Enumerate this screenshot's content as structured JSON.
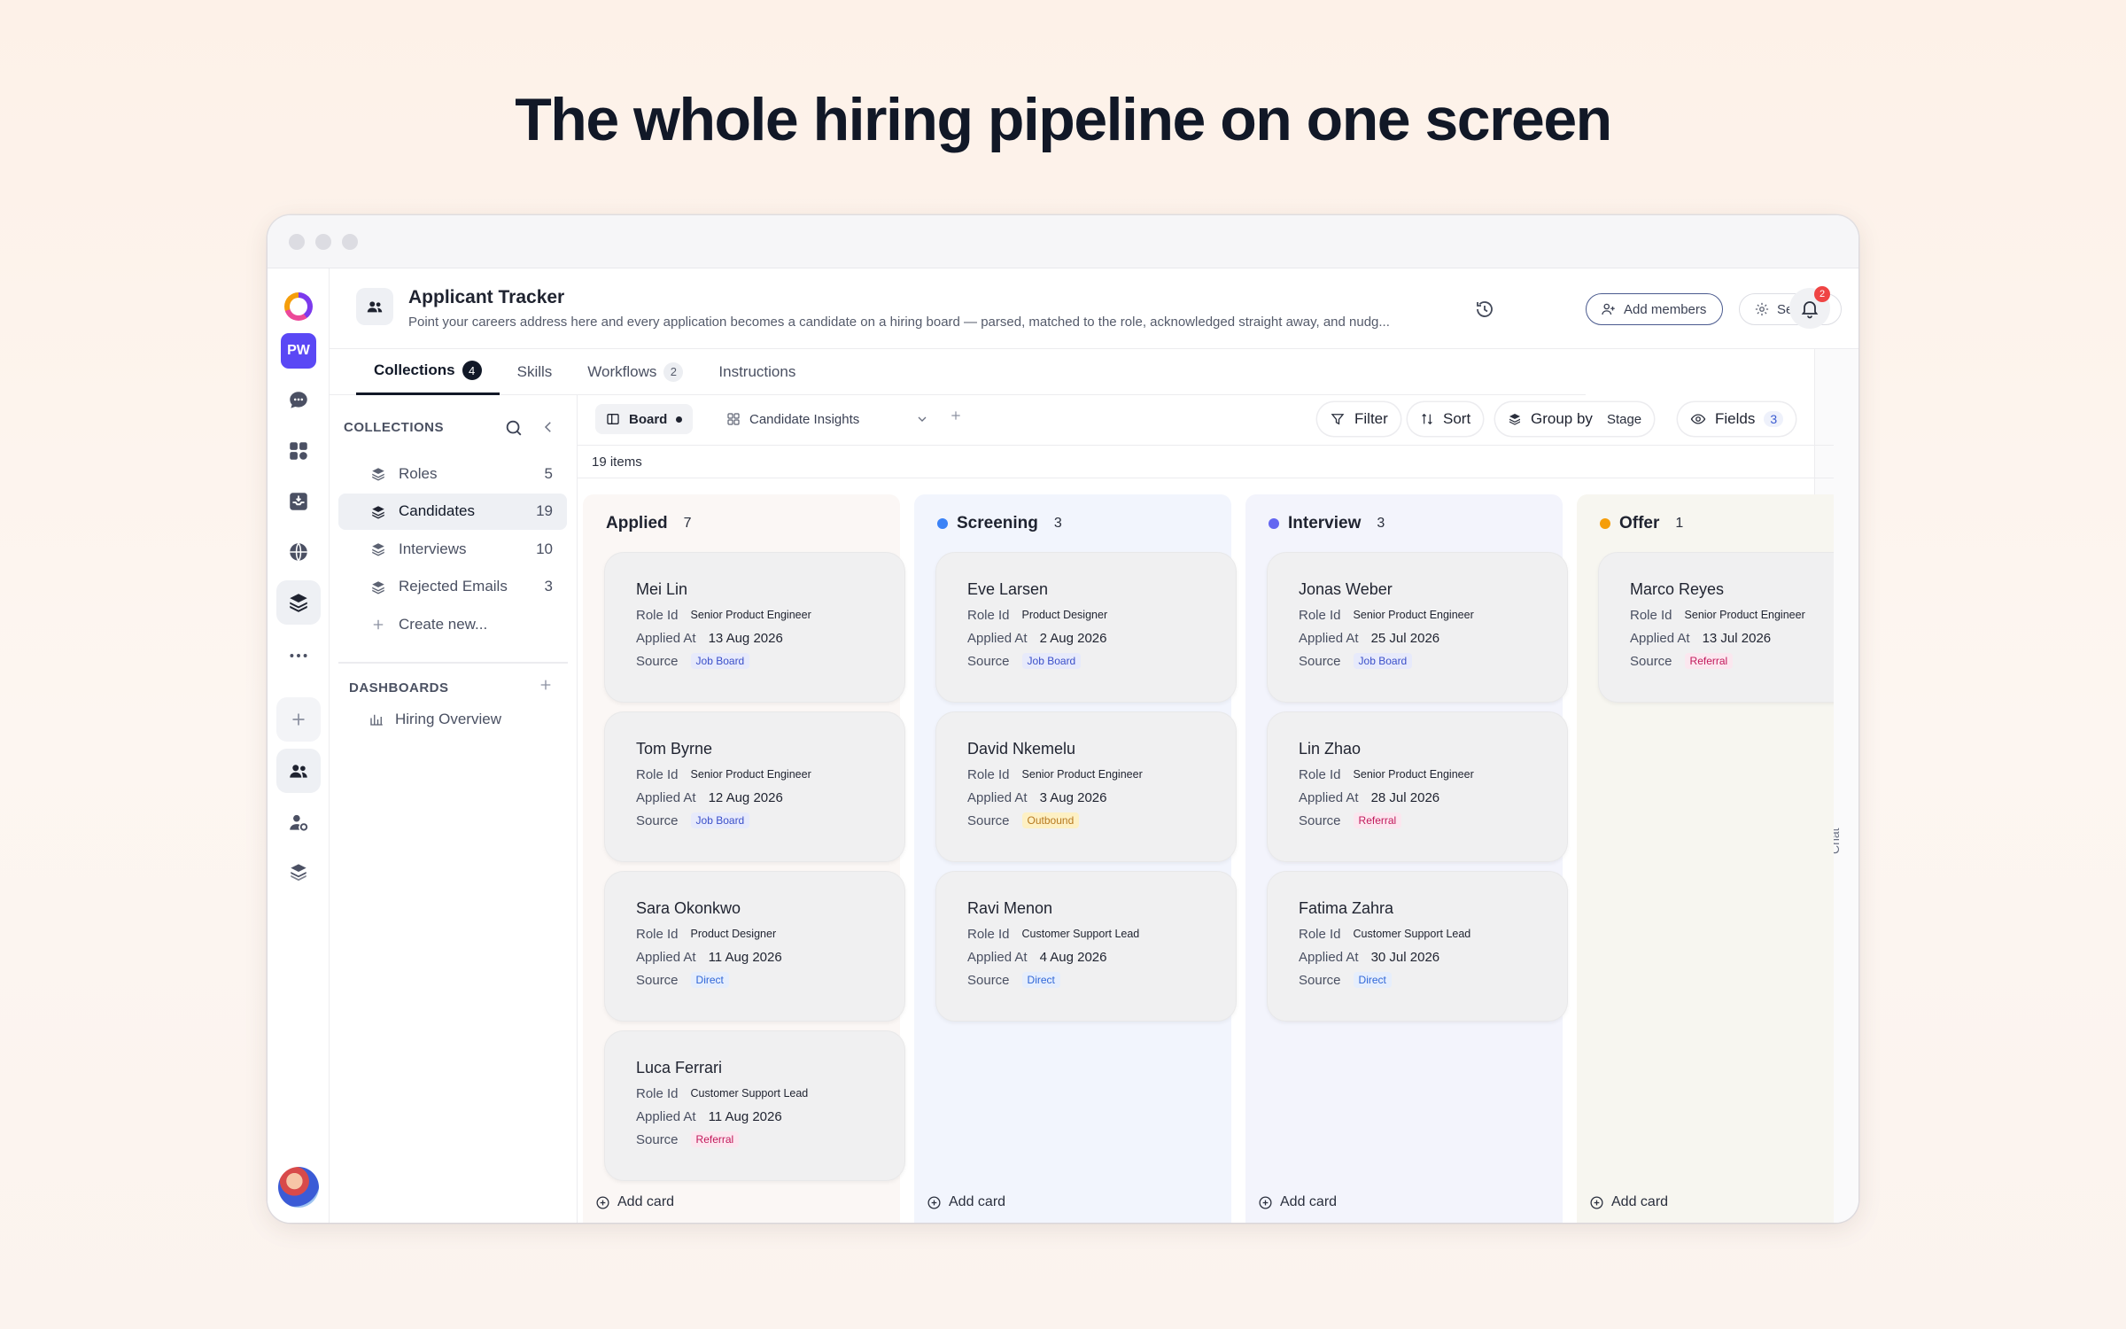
{
  "headline": "The whole hiring pipeline on one screen",
  "rail": {
    "badge": "PW"
  },
  "header": {
    "title": "Applicant Tracker",
    "description": "Point your careers address here and every application becomes a candidate on a hiring board — parsed, matched to the role, acknowledged straight away, and nudg...",
    "add_members": "Add members",
    "settings": "Settings",
    "notifications": "2"
  },
  "tabs": [
    {
      "label": "Collections",
      "count": "4"
    },
    {
      "label": "Skills",
      "count": ""
    },
    {
      "label": "Workflows",
      "count": "2"
    },
    {
      "label": "Instructions",
      "count": ""
    }
  ],
  "chat_label": "Chat",
  "sidebar": {
    "heading": "COLLECTIONS",
    "items": [
      {
        "label": "Roles",
        "count": "5"
      },
      {
        "label": "Candidates",
        "count": "19"
      },
      {
        "label": "Interviews",
        "count": "10"
      },
      {
        "label": "Rejected Emails",
        "count": "3"
      }
    ],
    "create_new": "Create new...",
    "dashboards_heading": "DASHBOARDS",
    "dashboard_item": "Hiring Overview"
  },
  "toolbar": {
    "board": "Board",
    "insights": "Candidate Insights",
    "filter": "Filter",
    "sort": "Sort",
    "group_by": "Group by",
    "group_value": "Stage",
    "fields": "Fields",
    "fields_count": "3"
  },
  "items_count": "19 items",
  "colors": {
    "source_job_board": "#3a4fc9",
    "source_referral": "#c2185b",
    "source_direct": "#2f66d8",
    "source_outbound": "#b7791f"
  },
  "columns": [
    {
      "name": "Applied",
      "count": "7",
      "dot": "",
      "bg": "#fbf7f5",
      "add": "Add card",
      "cards": [
        {
          "name": "Mei Lin",
          "role_label": "Role Id",
          "role": "Senior Product Engineer",
          "applied_label": "Applied At",
          "applied": "13 Aug 2026",
          "source_label": "Source",
          "source": "Job Board",
          "source_type": "job"
        },
        {
          "name": "Tom Byrne",
          "role_label": "Role Id",
          "role": "Senior Product Engineer",
          "applied_label": "Applied At",
          "applied": "12 Aug 2026",
          "source_label": "Source",
          "source": "Job Board",
          "source_type": "job"
        },
        {
          "name": "Sara Okonkwo",
          "role_label": "Role Id",
          "role": "Product Designer",
          "applied_label": "Applied At",
          "applied": "11 Aug 2026",
          "source_label": "Source",
          "source": "Direct",
          "source_type": "direct"
        },
        {
          "name": "Luca Ferrari",
          "role_label": "Role Id",
          "role": "Customer Support Lead",
          "applied_label": "Applied At",
          "applied": "11 Aug 2026",
          "source_label": "Source",
          "source": "Referral",
          "source_type": "referral"
        }
      ]
    },
    {
      "name": "Screening",
      "count": "3",
      "dot": "#3b82f6",
      "bg": "#f2f5fd",
      "add": "Add card",
      "cards": [
        {
          "name": "Eve Larsen",
          "role_label": "Role Id",
          "role": "Product Designer",
          "applied_label": "Applied At",
          "applied": "2 Aug 2026",
          "source_label": "Source",
          "source": "Job Board",
          "source_type": "job"
        },
        {
          "name": "David Nkemelu",
          "role_label": "Role Id",
          "role": "Senior Product Engineer",
          "applied_label": "Applied At",
          "applied": "3 Aug 2026",
          "source_label": "Source",
          "source": "Outbound",
          "source_type": "outbound"
        },
        {
          "name": "Ravi Menon",
          "role_label": "Role Id",
          "role": "Customer Support Lead",
          "applied_label": "Applied At",
          "applied": "4 Aug 2026",
          "source_label": "Source",
          "source": "Direct",
          "source_type": "direct"
        }
      ]
    },
    {
      "name": "Interview",
      "count": "3",
      "dot": "#6366f1",
      "bg": "#f3f4fc",
      "add": "Add card",
      "cards": [
        {
          "name": "Jonas Weber",
          "role_label": "Role Id",
          "role": "Senior Product Engineer",
          "applied_label": "Applied At",
          "applied": "25 Jul 2026",
          "source_label": "Source",
          "source": "Job Board",
          "source_type": "job"
        },
        {
          "name": "Lin Zhao",
          "role_label": "Role Id",
          "role": "Senior Product Engineer",
          "applied_label": "Applied At",
          "applied": "28 Jul 2026",
          "source_label": "Source",
          "source": "Referral",
          "source_type": "referral"
        },
        {
          "name": "Fatima Zahra",
          "role_label": "Role Id",
          "role": "Customer Support Lead",
          "applied_label": "Applied At",
          "applied": "30 Jul 2026",
          "source_label": "Source",
          "source": "Direct",
          "source_type": "direct"
        }
      ]
    },
    {
      "name": "Offer",
      "count": "1",
      "dot": "#f59e0b",
      "bg": "#f7f6f0",
      "add": "Add card",
      "cards": [
        {
          "name": "Marco Reyes",
          "role_label": "Role Id",
          "role": "Senior Product Engineer",
          "applied_label": "Applied At",
          "applied": "13 Jul 2026",
          "source_label": "Source",
          "source": "Referral",
          "source_type": "referral"
        }
      ]
    }
  ]
}
